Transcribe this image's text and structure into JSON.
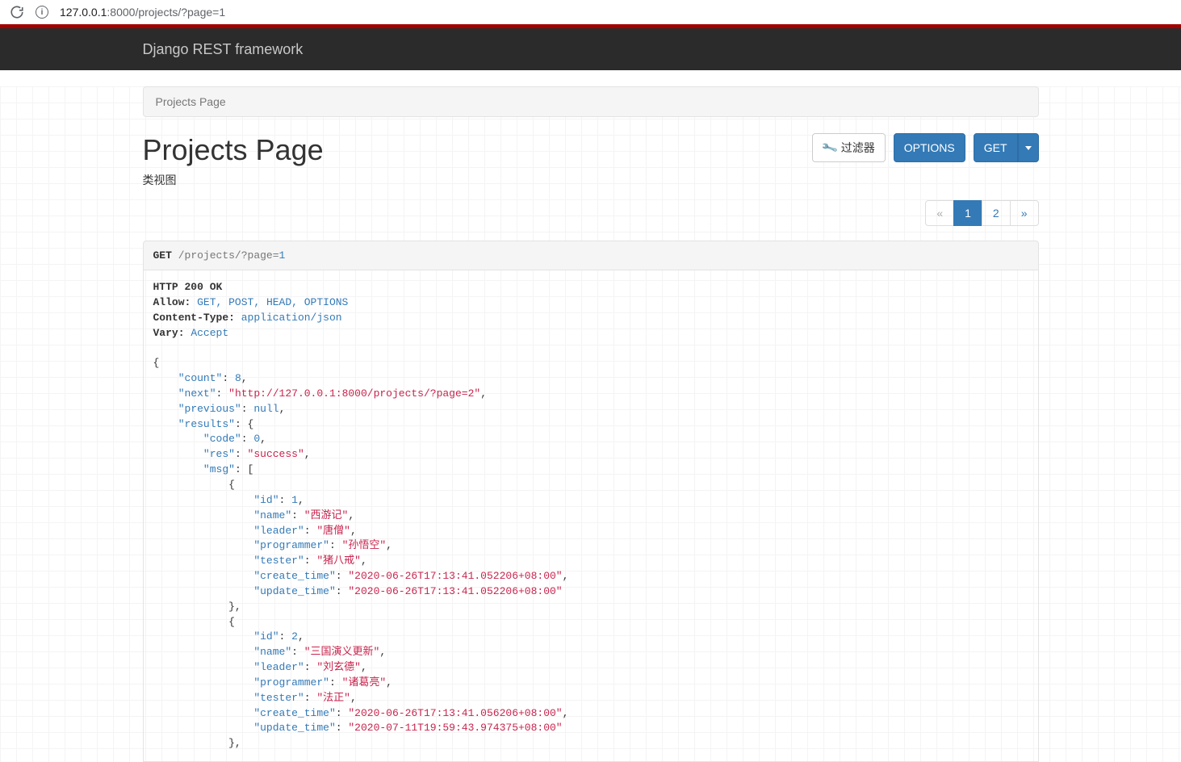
{
  "browser": {
    "url_host": "127.0.0.1",
    "url_port": ":8000",
    "url_path": "/projects/?page=1"
  },
  "navbar": {
    "brand": "Django REST framework"
  },
  "breadcrumb": {
    "label": "Projects Page"
  },
  "page": {
    "title": "Projects Page",
    "description": "类视图"
  },
  "buttons": {
    "filter": "过滤器",
    "options": "OPTIONS",
    "get": "GET"
  },
  "pagination": {
    "prev": "«",
    "pages": [
      "1",
      "2"
    ],
    "active_index": 0,
    "next": "»"
  },
  "request": {
    "method": "GET",
    "path": "/projects/?page=",
    "page_value": "1"
  },
  "response": {
    "status_line": "HTTP 200 OK",
    "headers": [
      {
        "name": "Allow:",
        "value": "GET, POST, HEAD, OPTIONS"
      },
      {
        "name": "Content-Type:",
        "value": "application/json"
      },
      {
        "name": "Vary:",
        "value": "Accept"
      }
    ],
    "body": {
      "count": 8,
      "next": "http://127.0.0.1:8000/projects/?page=2",
      "previous": null,
      "results": {
        "code": 0,
        "res": "success",
        "msg": [
          {
            "id": 1,
            "name": "西游记",
            "leader": "唐僧",
            "programmer": "孙悟空",
            "tester": "猪八戒",
            "create_time": "2020-06-26T17:13:41.052206+08:00",
            "update_time": "2020-06-26T17:13:41.052206+08:00"
          },
          {
            "id": 2,
            "name": "三国演义更新",
            "leader": "刘玄德",
            "programmer": "诸葛亮",
            "tester": "法正",
            "create_time": "2020-06-26T17:13:41.056206+08:00",
            "update_time": "2020-07-11T19:59:43.974375+08:00"
          }
        ]
      }
    }
  }
}
